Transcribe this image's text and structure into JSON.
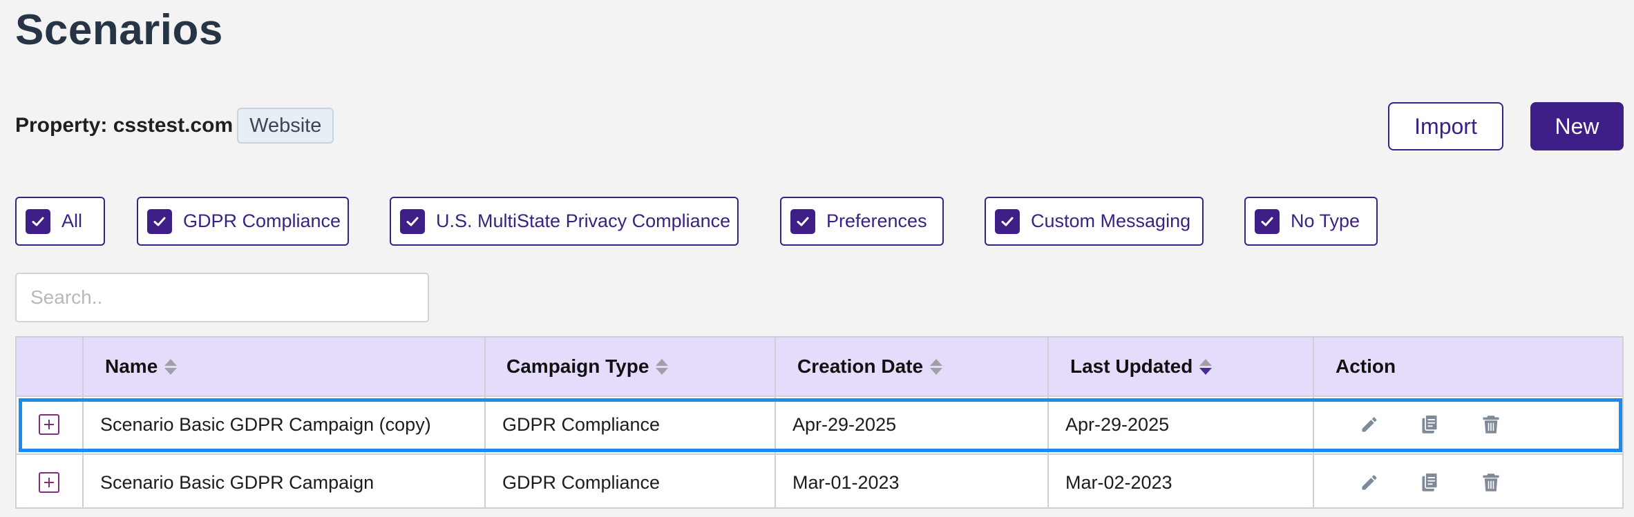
{
  "page": {
    "title": "Scenarios"
  },
  "property": {
    "label": "Property: csstest.com",
    "type_badge": "Website"
  },
  "toolbar": {
    "import_label": "Import",
    "new_label": "New"
  },
  "filters": [
    {
      "label": "All",
      "checked": true
    },
    {
      "label": "GDPR Compliance",
      "checked": true
    },
    {
      "label": "U.S. MultiState Privacy Compliance",
      "checked": true
    },
    {
      "label": "Preferences",
      "checked": true
    },
    {
      "label": "Custom Messaging",
      "checked": true
    },
    {
      "label": "No Type",
      "checked": true
    }
  ],
  "search": {
    "placeholder": "Search..",
    "value": ""
  },
  "table": {
    "columns": [
      "Name",
      "Campaign Type",
      "Creation Date",
      "Last Updated",
      "Action"
    ],
    "sorted_column": "Last Updated",
    "sort_direction": "descending",
    "rows": [
      {
        "name": "Scenario Basic GDPR Campaign (copy)",
        "campaign_type": "GDPR Compliance",
        "creation_date": "Apr-29-2025",
        "last_updated": "Apr-29-2025",
        "selected": true
      },
      {
        "name": "Scenario Basic GDPR Campaign",
        "campaign_type": "GDPR Compliance",
        "creation_date": "Mar-01-2023",
        "last_updated": "Mar-02-2023",
        "selected": false
      }
    ],
    "row_actions": [
      "pencil-icon",
      "copy-icon",
      "trash-icon"
    ]
  },
  "colors": {
    "accent": "#3e1f88",
    "header_bg": "#e5dcfb",
    "selection_outline": "#1a8cf0",
    "icon_gray": "#7f8a99",
    "expand_icon": "#7d2f7d"
  }
}
